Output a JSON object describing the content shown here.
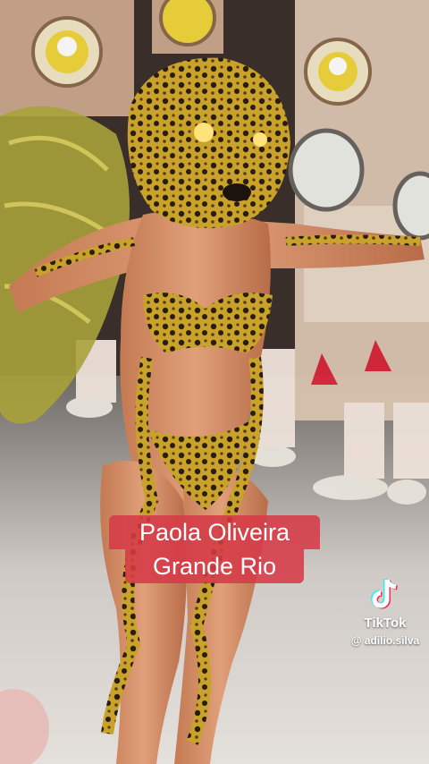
{
  "caption": {
    "line1": "Paola Oliveira",
    "line2": "Grande Rio"
  },
  "watermark": {
    "brand": "TikTok",
    "username": "@ adilio.silva",
    "icon": "tiktok-logo-icon"
  },
  "colors": {
    "caption_bg": "#d63a48",
    "caption_text": "#ffffff"
  }
}
